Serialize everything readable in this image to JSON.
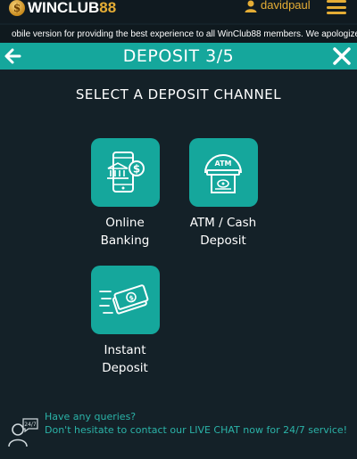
{
  "brand": {
    "name": "WINCLUB",
    "number": "88"
  },
  "user": {
    "name": "davidpaul"
  },
  "announcement": "obile version for providing the best experience to all WinClub88 members. We apologize for any",
  "header": {
    "title": "DEPOSIT 3/5"
  },
  "section_title": "SELECT A DEPOSIT CHANNEL",
  "channels": [
    {
      "label": "Online\nBanking",
      "icon": "online-banking-icon"
    },
    {
      "label": "ATM / Cash\nDeposit",
      "icon": "atm-icon"
    },
    {
      "label": "Instant\nDeposit",
      "icon": "instant-deposit-icon"
    }
  ],
  "atm_icon_text": "ATM",
  "help": {
    "line1": "Have any queries?",
    "line2": "Don't hesitate to contact our LIVE CHAT now for 24/7 service!",
    "badge": "24/7"
  },
  "colors": {
    "accent": "#15a79c",
    "gold": "#e5ad35",
    "background": "#142128"
  }
}
